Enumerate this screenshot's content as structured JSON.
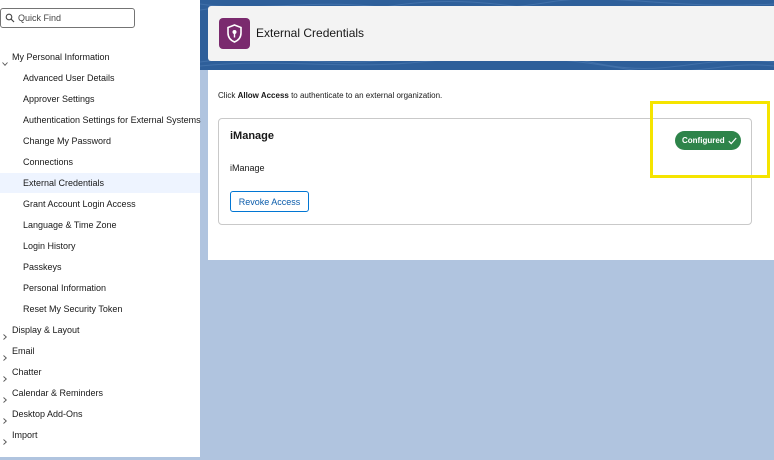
{
  "search": {
    "placeholder": "Quick Find",
    "icon": "search-icon"
  },
  "sidebar": {
    "section": {
      "label": "My Personal Information",
      "expanded": true
    },
    "items": [
      {
        "label": "Advanced User Details"
      },
      {
        "label": "Approver Settings"
      },
      {
        "label": "Authentication Settings for External Systems"
      },
      {
        "label": "Change My Password"
      },
      {
        "label": "Connections"
      },
      {
        "label": "External Credentials",
        "active": true
      },
      {
        "label": "Grant Account Login Access"
      },
      {
        "label": "Language & Time Zone"
      },
      {
        "label": "Login History"
      },
      {
        "label": "Passkeys"
      },
      {
        "label": "Personal Information"
      },
      {
        "label": "Reset My Security Token"
      }
    ],
    "collapsed_sections": [
      {
        "label": "Display & Layout"
      },
      {
        "label": "Email"
      },
      {
        "label": "Chatter"
      },
      {
        "label": "Calendar & Reminders"
      },
      {
        "label": "Desktop Add-Ons"
      },
      {
        "label": "Import"
      }
    ]
  },
  "header": {
    "title": "External Credentials",
    "icon": "shield-key-icon"
  },
  "content": {
    "intro_prefix": "Click ",
    "intro_bold": "Allow Access",
    "intro_suffix": " to authenticate to an external organization."
  },
  "credential": {
    "title": "iManage",
    "description": "iManage",
    "status": "Configured",
    "status_icon": "check-icon",
    "revoke_label": "Revoke Access"
  },
  "colors": {
    "active_bg": "#eef4ff",
    "banner": "#2e5f9a",
    "page_bg": "#b0c4df",
    "app_icon": "#7a2a6e",
    "status_green": "#2e844a",
    "button_blue": "#0176d3",
    "highlight": "#f5e400"
  }
}
